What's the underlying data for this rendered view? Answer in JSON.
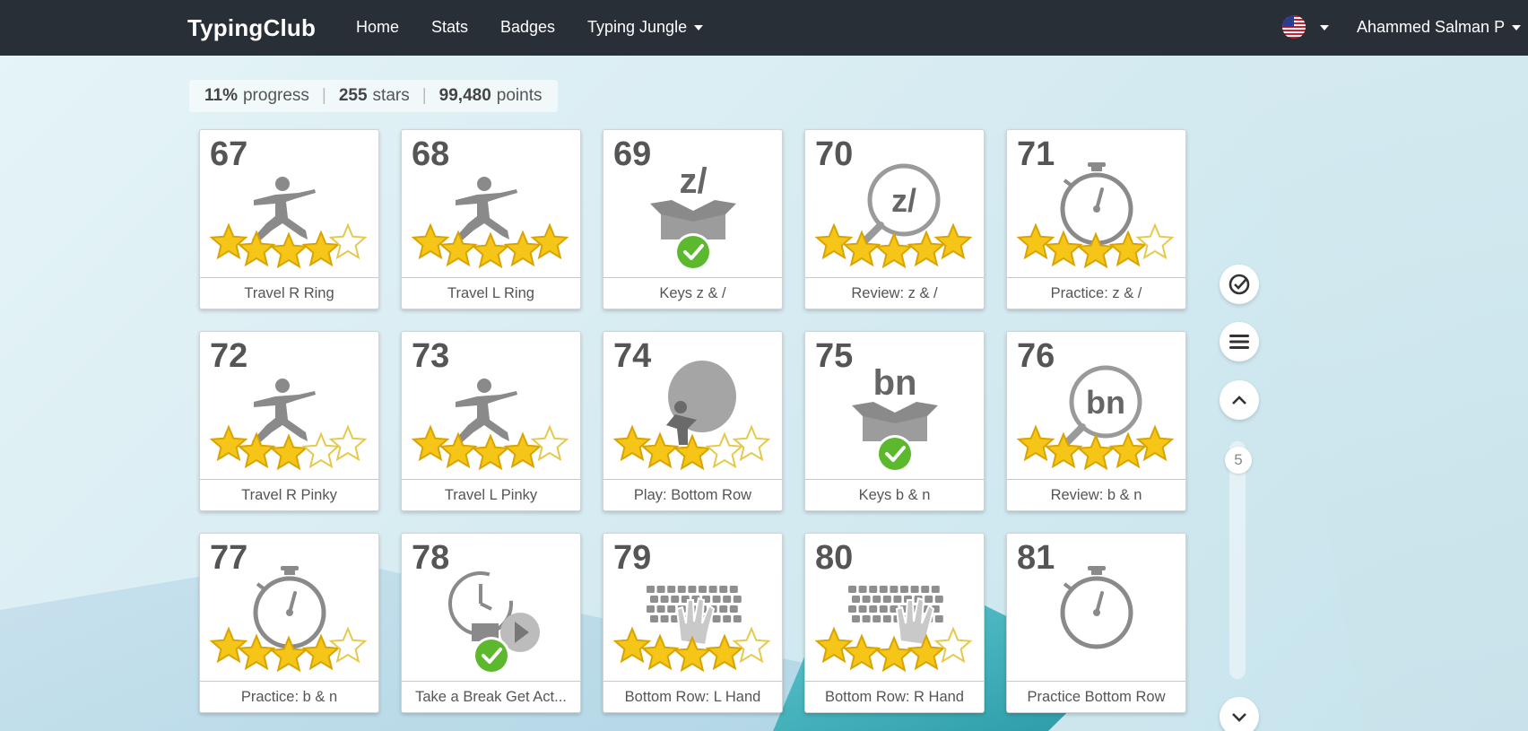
{
  "navbar": {
    "brand": "TypingClub",
    "links": [
      "Home",
      "Stats",
      "Badges",
      "Typing Jungle"
    ],
    "user": "Ahammed Salman P"
  },
  "progress": {
    "percent": "11%",
    "percent_label": "progress",
    "stars": "255",
    "stars_label": "stars",
    "points": "99,480",
    "points_label": "points"
  },
  "lessons": [
    {
      "num": "67",
      "title": "Travel R Ring",
      "icon": "yoga-icon",
      "stars": 4
    },
    {
      "num": "68",
      "title": "Travel L Ring",
      "icon": "yoga-icon",
      "stars": 5
    },
    {
      "num": "69",
      "title": "Keys z & /",
      "icon": "keys-box-icon",
      "keys": "z/",
      "stars": 0,
      "check": true
    },
    {
      "num": "70",
      "title": "Review: z & /",
      "icon": "magnifier-icon",
      "keys": "z/",
      "stars": 5
    },
    {
      "num": "71",
      "title": "Practice: z & /",
      "icon": "stopwatch-icon",
      "stars": 4
    },
    {
      "num": "72",
      "title": "Travel R Pinky",
      "icon": "yoga-icon",
      "stars": 3
    },
    {
      "num": "73",
      "title": "Travel L Pinky",
      "icon": "yoga-icon",
      "stars": 4
    },
    {
      "num": "74",
      "title": "Play: Bottom Row",
      "icon": "balloon-icon",
      "stars": 3
    },
    {
      "num": "75",
      "title": "Keys b & n",
      "icon": "keys-box-icon",
      "keys": "bn",
      "stars": 0,
      "check": true
    },
    {
      "num": "76",
      "title": "Review: b & n",
      "icon": "magnifier-icon",
      "keys": "bn",
      "stars": 5
    },
    {
      "num": "77",
      "title": "Practice: b & n",
      "icon": "stopwatch-icon",
      "stars": 4
    },
    {
      "num": "78",
      "title": "Take a Break Get Act...",
      "icon": "break-video-icon",
      "stars": 0,
      "check": true
    },
    {
      "num": "79",
      "title": "Bottom Row: L Hand",
      "icon": "keyboard-left-hand-icon",
      "stars": 4
    },
    {
      "num": "80",
      "title": "Bottom Row: R Hand",
      "icon": "keyboard-right-hand-icon",
      "stars": 4
    },
    {
      "num": "81",
      "title": "Practice Bottom Row",
      "icon": "stopwatch-icon",
      "stars": 0
    }
  ],
  "scroll": {
    "page": "5"
  },
  "colors": {
    "navbar": "#282f37",
    "star": "#f5c518",
    "check": "#5cb82d",
    "icon_gray": "#8a8a8a"
  }
}
